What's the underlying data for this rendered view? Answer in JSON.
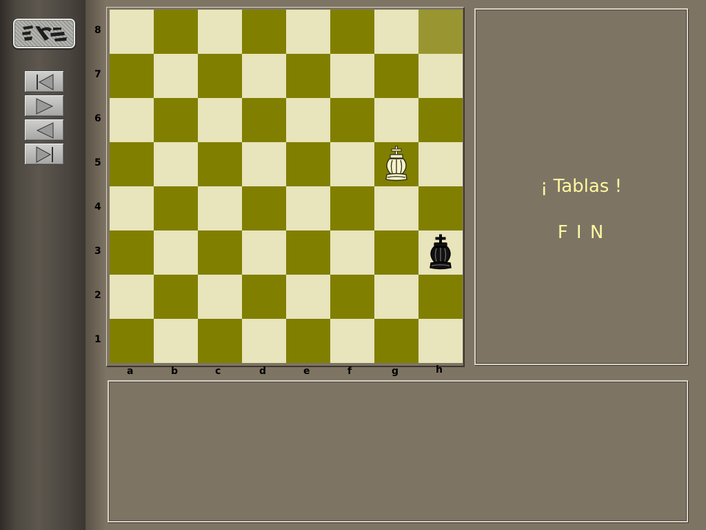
{
  "board": {
    "files": [
      "a",
      "b",
      "c",
      "d",
      "e",
      "f",
      "g",
      "h"
    ],
    "ranks": [
      "8",
      "7",
      "6",
      "5",
      "4",
      "3",
      "2",
      "1"
    ],
    "highlight_square": "h8",
    "colors": {
      "light": "#e8e4bb",
      "dark": "#807f00",
      "highlight": "#999632"
    },
    "pieces": [
      {
        "square": "g5",
        "piece": "white-king"
      },
      {
        "square": "h3",
        "piece": "black-king"
      }
    ]
  },
  "navigation": {
    "buttons": [
      {
        "name": "first-move-button",
        "icon": "skip-back-icon"
      },
      {
        "name": "next-move-button",
        "icon": "play-forward-icon"
      },
      {
        "name": "previous-move-button",
        "icon": "play-back-icon"
      },
      {
        "name": "last-move-button",
        "icon": "skip-forward-icon"
      }
    ]
  },
  "result": {
    "status": "¡ Tablas !",
    "end": "F I N",
    "text_color": "#fbf7a0"
  },
  "logo": {
    "icon": "app-logo-icon"
  }
}
